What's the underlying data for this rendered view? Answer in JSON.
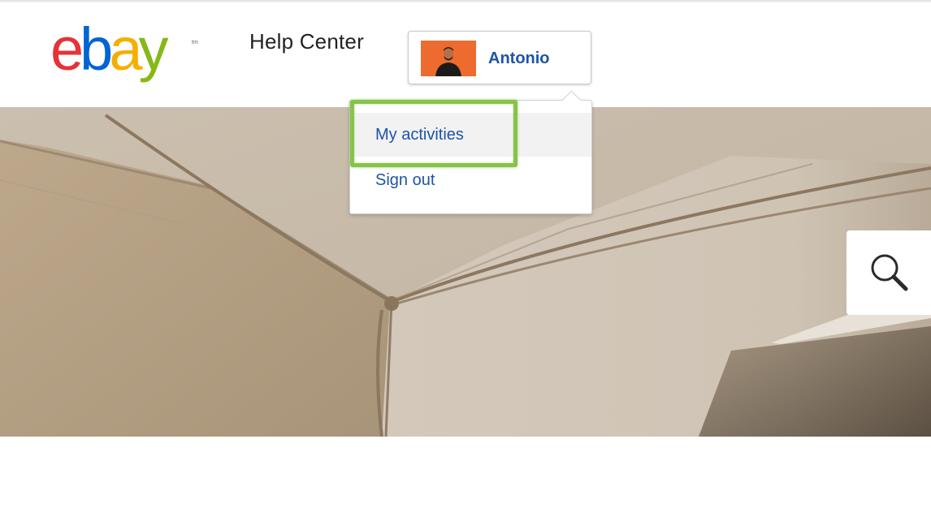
{
  "header": {
    "logo_text": "ebay",
    "logo_tm": "tm",
    "title": "Help Center",
    "user_name": "Antonio"
  },
  "user_menu": {
    "expanded": true,
    "items": [
      {
        "label": "My activities",
        "highlighted": true
      },
      {
        "label": "Sign out",
        "highlighted": false
      }
    ]
  },
  "search": {
    "icon": "search-icon"
  },
  "colors": {
    "logo_e": "#e53238",
    "logo_b": "#0064d2",
    "logo_a": "#f5af02",
    "logo_y": "#86b817",
    "link_blue": "#1e54a8",
    "highlight_green": "#86c449",
    "avatar_bg": "#ee6a2c"
  }
}
